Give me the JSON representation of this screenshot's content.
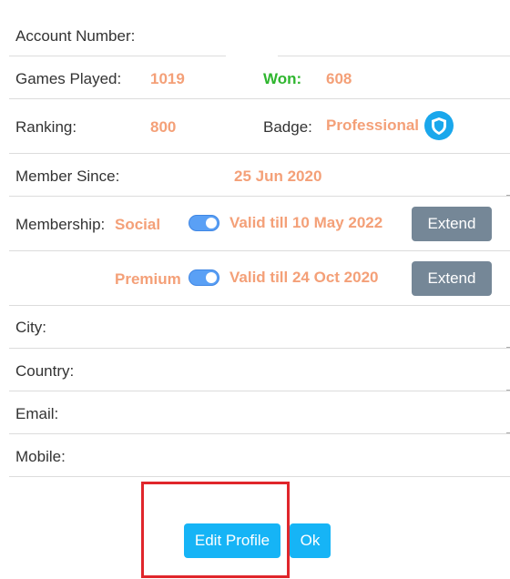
{
  "profile": {
    "account_number_label": "Account Number:",
    "games_played_label": "Games Played:",
    "games_played_value": "1019",
    "won_label": "Won:",
    "won_value": "608",
    "ranking_label": "Ranking:",
    "ranking_value": "800",
    "badge_label": "Badge:",
    "badge_value": "Professional",
    "badge_icon": "shield-icon",
    "member_since_label": "Member Since:",
    "member_since_value": "25 Jun 2020",
    "membership_label": "Membership:",
    "memberships": [
      {
        "type": "Social",
        "enabled": true,
        "valid_text": "Valid till 10 May 2022",
        "button_label": "Extend"
      },
      {
        "type": "Premium",
        "enabled": true,
        "valid_text": "Valid till 24 Oct 2020",
        "button_label": "Extend"
      }
    ],
    "city_label": "City:",
    "country_label": "Country:",
    "email_label": "Email:",
    "mobile_label": "Mobile:"
  },
  "actions": {
    "edit_profile_label": "Edit Profile",
    "ok_label": "Ok"
  },
  "colors": {
    "value_accent": "#f4a078",
    "won_green": "#2fb62f",
    "toggle_blue": "#5aa0f5",
    "extend_button": "#758797",
    "primary_button": "#16b4f6",
    "highlight_red": "#e0262b"
  }
}
